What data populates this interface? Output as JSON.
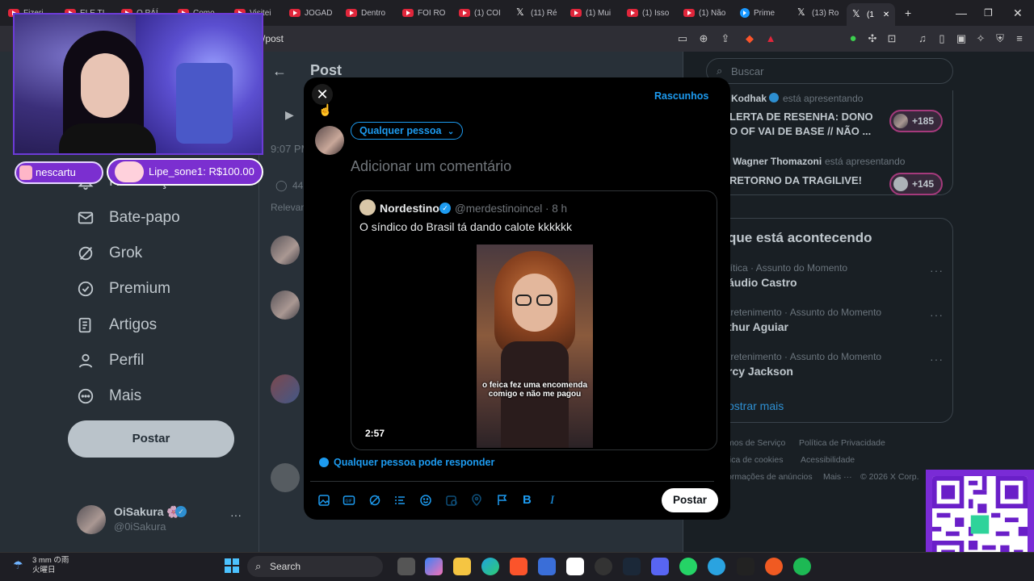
{
  "browser": {
    "tabs": [
      {
        "label": "Fizeri",
        "icon": "youtube-icon"
      },
      {
        "label": "ELE TI",
        "icon": "youtube-icon"
      },
      {
        "label": "O PÁÍ",
        "icon": "youtube-icon"
      },
      {
        "label": "Como",
        "icon": "youtube-icon"
      },
      {
        "label": "Visitei",
        "icon": "youtube-icon"
      },
      {
        "label": "JOGAD",
        "icon": "youtube-icon"
      },
      {
        "label": "Dentro",
        "icon": "youtube-icon"
      },
      {
        "label": "FOI RO",
        "icon": "youtube-icon"
      },
      {
        "label": "(1) COI",
        "icon": "youtube-icon"
      },
      {
        "label": "(11) Ré",
        "icon": "x-icon"
      },
      {
        "label": "(1) Mui",
        "icon": "youtube-icon"
      },
      {
        "label": "(1) Isso",
        "icon": "youtube-icon"
      },
      {
        "label": "(1) Não",
        "icon": "youtube-icon"
      },
      {
        "label": "Prime",
        "icon": "prime-video-icon"
      },
      {
        "label": "(13) Ro",
        "icon": "x-icon"
      },
      {
        "label": "(1",
        "icon": "x-icon"
      }
    ],
    "new_tab": "+",
    "url": "/post"
  },
  "nav": {
    "items": [
      {
        "label": "Notificações",
        "icon": "bell-icon"
      },
      {
        "label": "Bate-papo",
        "icon": "envelope-icon"
      },
      {
        "label": "Grok",
        "icon": "grok-icon"
      },
      {
        "label": "Premium",
        "icon": "verified-badge-icon"
      },
      {
        "label": "Artigos",
        "icon": "article-icon"
      },
      {
        "label": "Perfil",
        "icon": "person-icon"
      },
      {
        "label": "Mais",
        "icon": "more-circle-icon"
      }
    ],
    "post_button": "Postar",
    "profile": {
      "name": "OiSakura 🌸",
      "handle": "@0iSakura",
      "more": "···"
    }
  },
  "feed": {
    "back": "←",
    "title": "Post",
    "timestamp": "9:07 PM",
    "reply_count": "44",
    "sort_label": "Relevan"
  },
  "right": {
    "search_placeholder": "Buscar",
    "spaces": [
      {
        "host": "Kodhak",
        "status": "está apresentando",
        "title_line1": "LERTA DE RESENHA: DONO",
        "title_line2": "O OF VAI DE BASE // NÃO ...",
        "count": "+185"
      },
      {
        "host": "Wagner Thomazoni",
        "status": "está apresentando",
        "title_line1": "RETORNO DA TRAGILIVE!",
        "title_line2": "",
        "count": "+145"
      }
    ],
    "trends_header": "que está acontecendo",
    "trends": [
      {
        "meta": "lítica · Assunto do Momento",
        "title": "áudio Castro"
      },
      {
        "meta": "tretenimento · Assunto do Momento",
        "title": "thur Aguiar"
      },
      {
        "meta": "tretenimento · Assunto do Momento",
        "title": "rcy Jackson"
      }
    ],
    "show_more": "ostrar mais",
    "footer": [
      "mos de Serviço",
      "Política de Privacidade",
      "tica de cookies",
      "Acessibilidade",
      "ormações de anúncios",
      "Mais ···",
      "© 2026 X Corp."
    ]
  },
  "modal": {
    "close": "✕",
    "drafts": "Rascunhos",
    "audience": "Qualquer pessoa",
    "placeholder": "Adicionar um comentário",
    "quote": {
      "name": "Nordestino",
      "handle": "@merdestinoincel · 8 h",
      "text": "O síndico do Brasil tá dando calote kkkkkk",
      "video_caption": "o feica fez uma encomenda comigo e não me pagou",
      "duration": "2:57"
    },
    "reply_setting": "Qualquer pessoa pode responder",
    "tools": [
      "image-icon",
      "gif-icon",
      "grok-icon",
      "poll-icon",
      "emoji-icon",
      "schedule-icon",
      "location-icon",
      "flag-icon",
      "bold-icon",
      "italic-icon"
    ],
    "bold_label": "B",
    "italic_label": "I",
    "post_button": "Postar"
  },
  "stream": {
    "alert1": "nescartu",
    "alert2": "Lipe_sone1: R$100.00"
  },
  "taskbar": {
    "weather_line1": "3 mm の雨",
    "weather_line2": "火曜日",
    "search": "Search"
  },
  "colors": {
    "accent": "#1d9bf0",
    "stream_purple": "#7b2fd0"
  }
}
